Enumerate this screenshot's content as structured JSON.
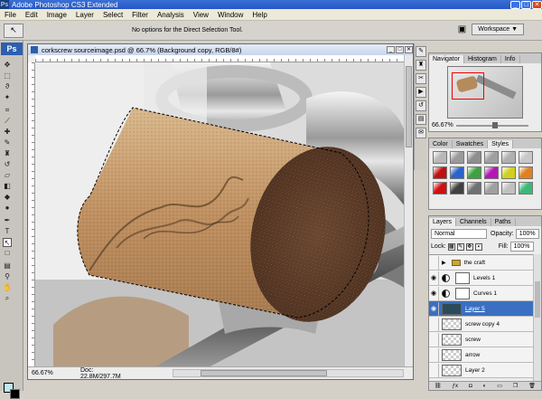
{
  "app": {
    "title": "Adobe Photoshop CS3 Extended",
    "logo": "Ps",
    "window_controls": [
      "_",
      "□",
      "✕"
    ]
  },
  "menu": [
    "File",
    "Edit",
    "Image",
    "Layer",
    "Select",
    "Filter",
    "Analysis",
    "View",
    "Window",
    "Help"
  ],
  "options_bar": {
    "message": "No options for the Direct Selection Tool.",
    "workspace_label": "Workspace ▼"
  },
  "document": {
    "title": "corkscrew sourceimage.psd @ 66.7% (Background copy, RGB/8#)",
    "zoom": "66.67%",
    "doc_info": "Doc: 22.8M/297.7M"
  },
  "panels": {
    "navigator": {
      "tabs": [
        "Navigator",
        "Histogram",
        "Info"
      ],
      "zoom": "66.67%"
    },
    "styles": {
      "tabs": [
        "Color",
        "Swatches",
        "Styles"
      ],
      "swatch_colors": [
        "#b8b8b8",
        "#9a9a9a",
        "#8e8e8e",
        "#a0a0a0",
        "#b0b0b0",
        "#c8c8c8",
        "#c01010",
        "#2b63c9",
        "#3fa13f",
        "#b317b3",
        "#d0d020",
        "#e08020",
        "#d01010",
        "#404040",
        "#707070",
        "#a0a0a0",
        "#c0c0c0",
        "#3cb878"
      ]
    },
    "layers": {
      "tabs": [
        "Layers",
        "Channels",
        "Paths"
      ],
      "blend_mode": "Normal",
      "opacity_label": "Opacity:",
      "opacity": "100%",
      "lock_label": "Lock:",
      "fill_label": "Fill:",
      "fill": "100%",
      "items": [
        {
          "name": "the craft",
          "type": "folder"
        },
        {
          "name": "Levels 1",
          "type": "adjustment"
        },
        {
          "name": "Curves 1",
          "type": "adjustment"
        },
        {
          "name": "Layer 5",
          "type": "pixel",
          "selected": true
        },
        {
          "name": "screw copy 4",
          "type": "pixel"
        },
        {
          "name": "screw",
          "type": "pixel"
        },
        {
          "name": "arrow",
          "type": "pixel"
        },
        {
          "name": "Layer 2",
          "type": "pixel"
        }
      ]
    }
  }
}
